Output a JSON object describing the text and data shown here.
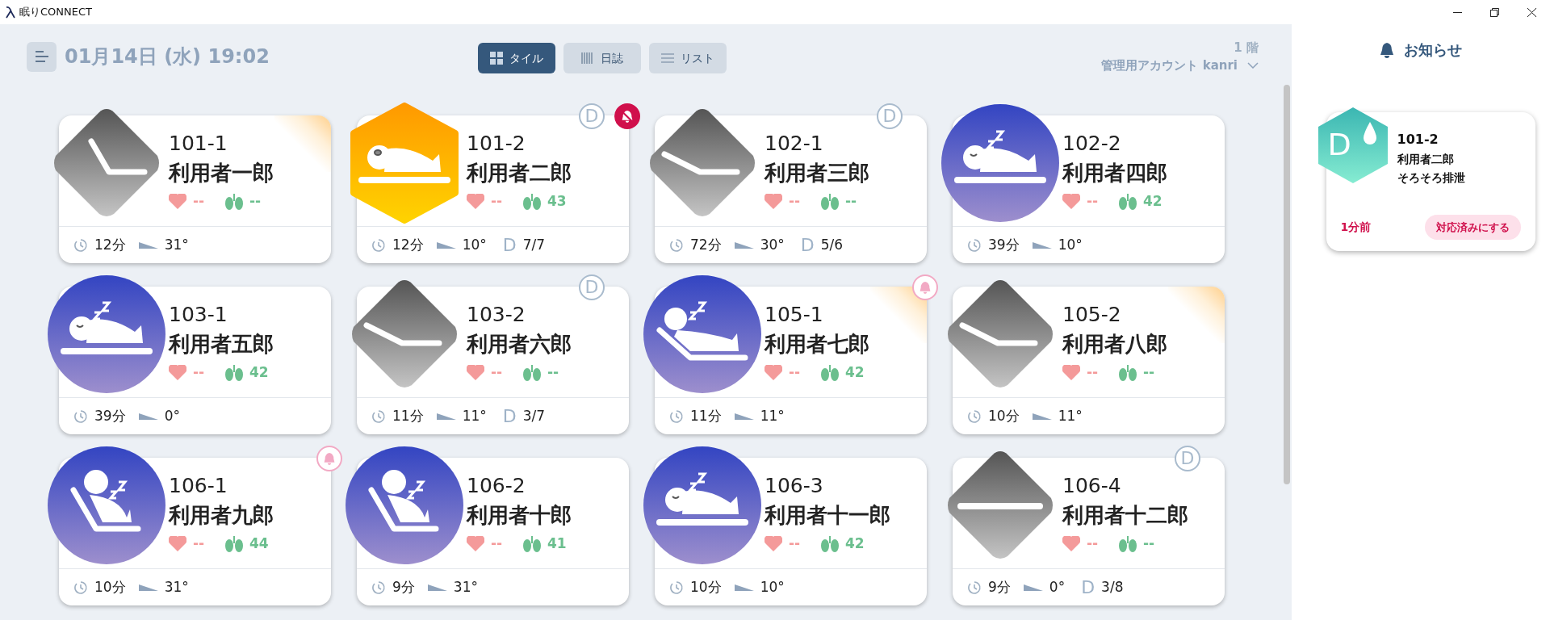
{
  "app": {
    "title": "眠りCONNECT"
  },
  "header": {
    "datetime": "01月14日 (水) 19:02",
    "floor": "1 階",
    "account": "管理用アカウント kanri",
    "views": [
      {
        "label": "タイル",
        "selected": true
      },
      {
        "label": "日誌",
        "selected": false
      },
      {
        "label": "リスト",
        "selected": false
      }
    ]
  },
  "residents": [
    {
      "room": "101-1",
      "name": "利用者一郎",
      "kind": "raised",
      "heart": "--",
      "breath": "--",
      "elapsed": "12分",
      "angle": "31°",
      "corner_alert": true,
      "call_alert": false,
      "call_pending": false
    },
    {
      "room": "101-2",
      "name": "利用者二郎",
      "kind": "awake",
      "heart": "--",
      "breath": "43",
      "elapsed": "12分",
      "angle": "10°",
      "diaper": {
        "mark": "D",
        "count": "7/7"
      },
      "d_badge": "D",
      "corner_alert": false,
      "call_alert": true,
      "call_pending": false
    },
    {
      "room": "102-1",
      "name": "利用者三郎",
      "kind": "incline",
      "heart": "--",
      "breath": "--",
      "elapsed": "72分",
      "angle": "30°",
      "diaper": {
        "mark": "D",
        "count": "5/6"
      },
      "d_badge": "D",
      "corner_alert": false,
      "call_alert": false,
      "call_pending": false
    },
    {
      "room": "102-2",
      "name": "利用者四郎",
      "kind": "lying",
      "heart": "--",
      "breath": "42",
      "elapsed": "39分",
      "angle": "10°",
      "corner_alert": false,
      "call_alert": false,
      "call_pending": false
    },
    {
      "room": "103-1",
      "name": "利用者五郎",
      "kind": "lying",
      "heart": "--",
      "breath": "42",
      "elapsed": "39分",
      "angle": "0°",
      "corner_alert": false,
      "call_alert": false,
      "call_pending": false
    },
    {
      "room": "103-2",
      "name": "利用者六郎",
      "kind": "incline",
      "heart": "--",
      "breath": "--",
      "elapsed": "11分",
      "angle": "11°",
      "diaper": {
        "mark": "D",
        "count": "3/7"
      },
      "d_badge": "D",
      "corner_alert": false,
      "call_alert": false,
      "call_pending": false
    },
    {
      "room": "105-1",
      "name": "利用者七郎",
      "kind": "reclined",
      "heart": "--",
      "breath": "42",
      "elapsed": "11分",
      "angle": "11°",
      "corner_alert": true,
      "call_alert": false,
      "call_pending": true
    },
    {
      "room": "105-2",
      "name": "利用者八郎",
      "kind": "incline",
      "heart": "--",
      "breath": "--",
      "elapsed": "10分",
      "angle": "11°",
      "corner_alert": true,
      "call_alert": false,
      "call_pending": false
    },
    {
      "room": "106-1",
      "name": "利用者九郎",
      "kind": "sitting",
      "heart": "--",
      "breath": "44",
      "elapsed": "10分",
      "angle": "31°",
      "corner_alert": false,
      "call_alert": false,
      "call_pending": true
    },
    {
      "room": "106-2",
      "name": "利用者十郎",
      "kind": "sitting",
      "heart": "--",
      "breath": "41",
      "elapsed": "9分",
      "angle": "31°",
      "corner_alert": false,
      "call_alert": false,
      "call_pending": false
    },
    {
      "room": "106-3",
      "name": "利用者十一郎",
      "kind": "lying",
      "heart": "--",
      "breath": "42",
      "elapsed": "10分",
      "angle": "10°",
      "corner_alert": false,
      "call_alert": false,
      "call_pending": false
    },
    {
      "room": "106-4",
      "name": "利用者十二郎",
      "kind": "flat",
      "heart": "--",
      "breath": "--",
      "elapsed": "9分",
      "angle": "0°",
      "diaper": {
        "mark": "D",
        "count": "3/8"
      },
      "d_badge": "D",
      "corner_alert": false,
      "call_alert": false,
      "call_pending": false
    }
  ],
  "notifications": {
    "title": "お知らせ",
    "items": [
      {
        "badge": "D",
        "room": "101-2",
        "name": "利用者二郎",
        "message": "そろそろ排泄",
        "time": "1分前",
        "action": "対応済みにする"
      }
    ]
  }
}
